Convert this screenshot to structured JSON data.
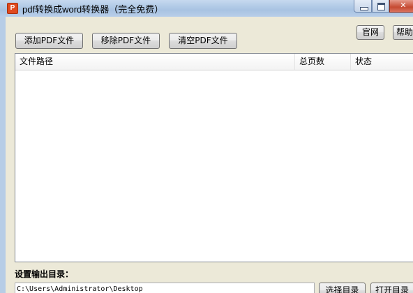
{
  "window": {
    "title": "pdf转换成word转换器（完全免费）",
    "icon_text": "P",
    "controls": [
      "minimize",
      "maximize",
      "close"
    ]
  },
  "toolbar": {
    "add_label": "添加PDF文件",
    "remove_label": "移除PDF文件",
    "clear_label": "清空PDF文件",
    "website_label": "官网",
    "help_label": "帮助"
  },
  "table": {
    "columns": [
      "文件路径",
      "总页数",
      "状态"
    ],
    "rows": []
  },
  "output": {
    "label": "设置输出目录：",
    "path": "C:\\Users\\Administrator\\Desktop",
    "choose_label": "选择目录",
    "open_label": "打开目录"
  },
  "colors": {
    "client_bg": "#ece9d8",
    "titlebar": "#b9d1ea",
    "close_button": "#c64a32"
  }
}
